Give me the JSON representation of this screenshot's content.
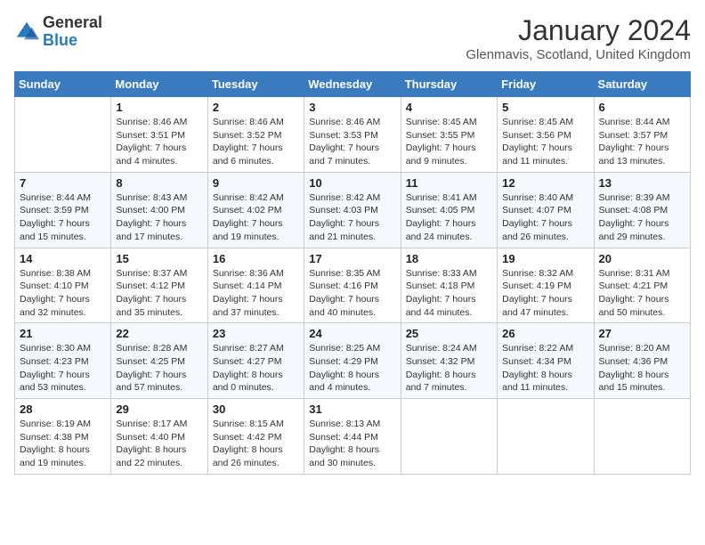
{
  "logo": {
    "general": "General",
    "blue": "Blue"
  },
  "title": "January 2024",
  "location": "Glenmavis, Scotland, United Kingdom",
  "weekdays": [
    "Sunday",
    "Monday",
    "Tuesday",
    "Wednesday",
    "Thursday",
    "Friday",
    "Saturday"
  ],
  "weeks": [
    [
      {
        "day": "",
        "sunrise": "",
        "sunset": "",
        "daylight": ""
      },
      {
        "day": "1",
        "sunrise": "Sunrise: 8:46 AM",
        "sunset": "Sunset: 3:51 PM",
        "daylight": "Daylight: 7 hours and 4 minutes."
      },
      {
        "day": "2",
        "sunrise": "Sunrise: 8:46 AM",
        "sunset": "Sunset: 3:52 PM",
        "daylight": "Daylight: 7 hours and 6 minutes."
      },
      {
        "day": "3",
        "sunrise": "Sunrise: 8:46 AM",
        "sunset": "Sunset: 3:53 PM",
        "daylight": "Daylight: 7 hours and 7 minutes."
      },
      {
        "day": "4",
        "sunrise": "Sunrise: 8:45 AM",
        "sunset": "Sunset: 3:55 PM",
        "daylight": "Daylight: 7 hours and 9 minutes."
      },
      {
        "day": "5",
        "sunrise": "Sunrise: 8:45 AM",
        "sunset": "Sunset: 3:56 PM",
        "daylight": "Daylight: 7 hours and 11 minutes."
      },
      {
        "day": "6",
        "sunrise": "Sunrise: 8:44 AM",
        "sunset": "Sunset: 3:57 PM",
        "daylight": "Daylight: 7 hours and 13 minutes."
      }
    ],
    [
      {
        "day": "7",
        "sunrise": "Sunrise: 8:44 AM",
        "sunset": "Sunset: 3:59 PM",
        "daylight": "Daylight: 7 hours and 15 minutes."
      },
      {
        "day": "8",
        "sunrise": "Sunrise: 8:43 AM",
        "sunset": "Sunset: 4:00 PM",
        "daylight": "Daylight: 7 hours and 17 minutes."
      },
      {
        "day": "9",
        "sunrise": "Sunrise: 8:42 AM",
        "sunset": "Sunset: 4:02 PM",
        "daylight": "Daylight: 7 hours and 19 minutes."
      },
      {
        "day": "10",
        "sunrise": "Sunrise: 8:42 AM",
        "sunset": "Sunset: 4:03 PM",
        "daylight": "Daylight: 7 hours and 21 minutes."
      },
      {
        "day": "11",
        "sunrise": "Sunrise: 8:41 AM",
        "sunset": "Sunset: 4:05 PM",
        "daylight": "Daylight: 7 hours and 24 minutes."
      },
      {
        "day": "12",
        "sunrise": "Sunrise: 8:40 AM",
        "sunset": "Sunset: 4:07 PM",
        "daylight": "Daylight: 7 hours and 26 minutes."
      },
      {
        "day": "13",
        "sunrise": "Sunrise: 8:39 AM",
        "sunset": "Sunset: 4:08 PM",
        "daylight": "Daylight: 7 hours and 29 minutes."
      }
    ],
    [
      {
        "day": "14",
        "sunrise": "Sunrise: 8:38 AM",
        "sunset": "Sunset: 4:10 PM",
        "daylight": "Daylight: 7 hours and 32 minutes."
      },
      {
        "day": "15",
        "sunrise": "Sunrise: 8:37 AM",
        "sunset": "Sunset: 4:12 PM",
        "daylight": "Daylight: 7 hours and 35 minutes."
      },
      {
        "day": "16",
        "sunrise": "Sunrise: 8:36 AM",
        "sunset": "Sunset: 4:14 PM",
        "daylight": "Daylight: 7 hours and 37 minutes."
      },
      {
        "day": "17",
        "sunrise": "Sunrise: 8:35 AM",
        "sunset": "Sunset: 4:16 PM",
        "daylight": "Daylight: 7 hours and 40 minutes."
      },
      {
        "day": "18",
        "sunrise": "Sunrise: 8:33 AM",
        "sunset": "Sunset: 4:18 PM",
        "daylight": "Daylight: 7 hours and 44 minutes."
      },
      {
        "day": "19",
        "sunrise": "Sunrise: 8:32 AM",
        "sunset": "Sunset: 4:19 PM",
        "daylight": "Daylight: 7 hours and 47 minutes."
      },
      {
        "day": "20",
        "sunrise": "Sunrise: 8:31 AM",
        "sunset": "Sunset: 4:21 PM",
        "daylight": "Daylight: 7 hours and 50 minutes."
      }
    ],
    [
      {
        "day": "21",
        "sunrise": "Sunrise: 8:30 AM",
        "sunset": "Sunset: 4:23 PM",
        "daylight": "Daylight: 7 hours and 53 minutes."
      },
      {
        "day": "22",
        "sunrise": "Sunrise: 8:28 AM",
        "sunset": "Sunset: 4:25 PM",
        "daylight": "Daylight: 7 hours and 57 minutes."
      },
      {
        "day": "23",
        "sunrise": "Sunrise: 8:27 AM",
        "sunset": "Sunset: 4:27 PM",
        "daylight": "Daylight: 8 hours and 0 minutes."
      },
      {
        "day": "24",
        "sunrise": "Sunrise: 8:25 AM",
        "sunset": "Sunset: 4:29 PM",
        "daylight": "Daylight: 8 hours and 4 minutes."
      },
      {
        "day": "25",
        "sunrise": "Sunrise: 8:24 AM",
        "sunset": "Sunset: 4:32 PM",
        "daylight": "Daylight: 8 hours and 7 minutes."
      },
      {
        "day": "26",
        "sunrise": "Sunrise: 8:22 AM",
        "sunset": "Sunset: 4:34 PM",
        "daylight": "Daylight: 8 hours and 11 minutes."
      },
      {
        "day": "27",
        "sunrise": "Sunrise: 8:20 AM",
        "sunset": "Sunset: 4:36 PM",
        "daylight": "Daylight: 8 hours and 15 minutes."
      }
    ],
    [
      {
        "day": "28",
        "sunrise": "Sunrise: 8:19 AM",
        "sunset": "Sunset: 4:38 PM",
        "daylight": "Daylight: 8 hours and 19 minutes."
      },
      {
        "day": "29",
        "sunrise": "Sunrise: 8:17 AM",
        "sunset": "Sunset: 4:40 PM",
        "daylight": "Daylight: 8 hours and 22 minutes."
      },
      {
        "day": "30",
        "sunrise": "Sunrise: 8:15 AM",
        "sunset": "Sunset: 4:42 PM",
        "daylight": "Daylight: 8 hours and 26 minutes."
      },
      {
        "day": "31",
        "sunrise": "Sunrise: 8:13 AM",
        "sunset": "Sunset: 4:44 PM",
        "daylight": "Daylight: 8 hours and 30 minutes."
      },
      {
        "day": "",
        "sunrise": "",
        "sunset": "",
        "daylight": ""
      },
      {
        "day": "",
        "sunrise": "",
        "sunset": "",
        "daylight": ""
      },
      {
        "day": "",
        "sunrise": "",
        "sunset": "",
        "daylight": ""
      }
    ]
  ]
}
